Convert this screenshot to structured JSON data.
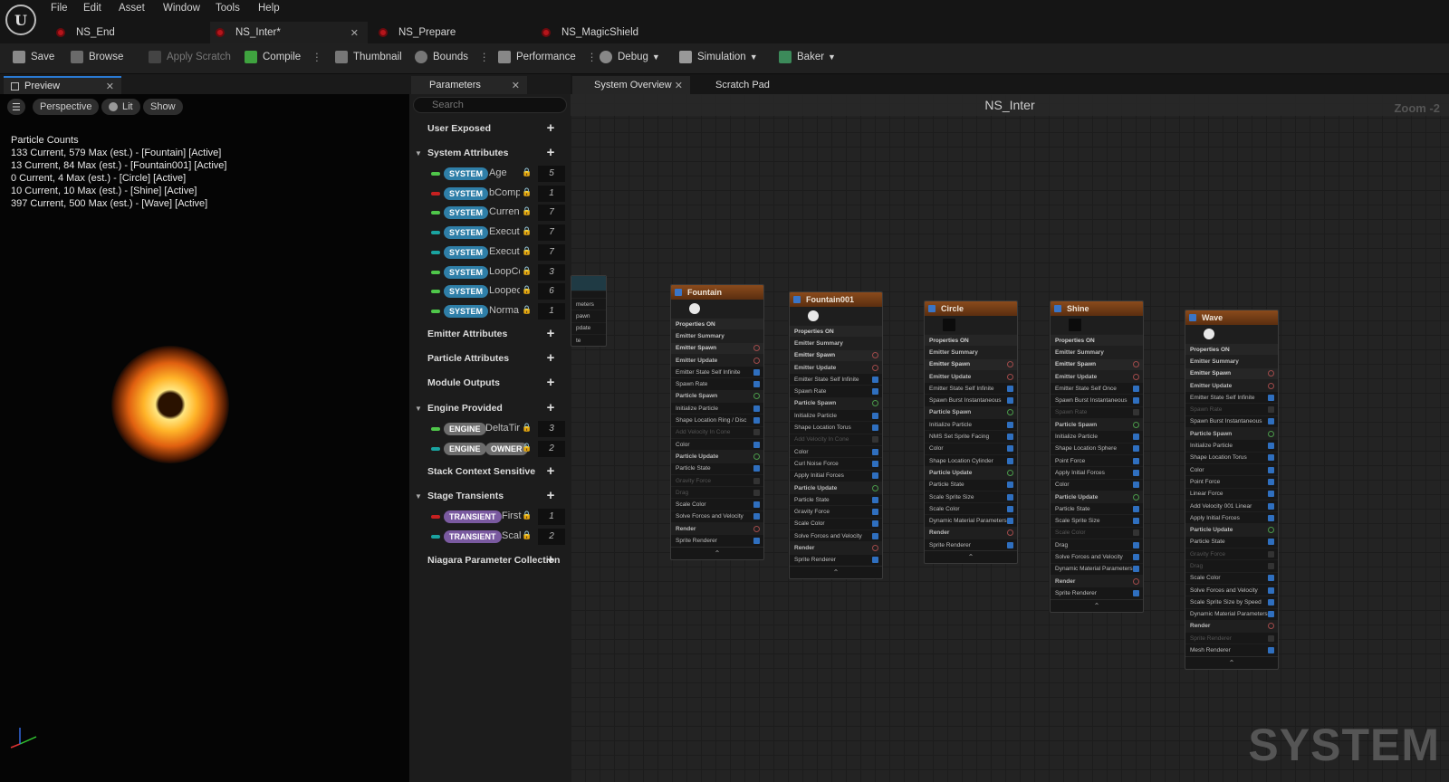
{
  "menu": {
    "items": [
      "File",
      "Edit",
      "Asset",
      "Window",
      "Tools",
      "Help"
    ]
  },
  "doc_tabs": [
    {
      "label": "NS_End"
    },
    {
      "label": "NS_Inter*"
    },
    {
      "label": "NS_Prepare"
    },
    {
      "label": "NS_MagicShield"
    }
  ],
  "toolbar": {
    "save": "Save",
    "browse": "Browse",
    "apply_scratch": "Apply Scratch",
    "compile": "Compile",
    "thumbnail": "Thumbnail",
    "bounds": "Bounds",
    "performance": "Performance",
    "debug": "Debug",
    "simulation": "Simulation",
    "baker": "Baker"
  },
  "preview": {
    "tab": "Preview",
    "perspective": "Perspective",
    "lit": "Lit",
    "show": "Show",
    "counts_title": "Particle Counts",
    "counts": [
      "133 Current, 579 Max (est.) - [Fountain] [Active]",
      "13 Current, 84 Max (est.) - [Fountain001] [Active]",
      "0 Current, 4 Max (est.) - [Circle] [Active]",
      "10 Current, 10 Max (est.) - [Shine] [Active]",
      "397 Current, 500 Max (est.) - [Wave] [Active]"
    ]
  },
  "parameters": {
    "tab": "Parameters",
    "search_placeholder": "Search",
    "categories": {
      "user_exposed": "User Exposed",
      "system_attributes": "System Attributes",
      "emitter_attributes": "Emitter Attributes",
      "particle_attributes": "Particle Attributes",
      "module_outputs": "Module Outputs",
      "engine_provided": "Engine Provided",
      "stack_context": "Stack Context Sensitive",
      "stage_transients": "Stage Transients",
      "niagara_collection": "Niagara Parameter Collection"
    },
    "system_rows": [
      {
        "tag": "SYSTEM",
        "name": "Age",
        "value": "5",
        "color": "#4fc64a"
      },
      {
        "tag": "SYSTEM",
        "name": "bComp",
        "value": "1",
        "color": "#c62020"
      },
      {
        "tag": "SYSTEM",
        "name": "Curren",
        "value": "7",
        "color": "#4fc64a"
      },
      {
        "tag": "SYSTEM",
        "name": "Execut",
        "value": "7",
        "color": "#1aa3a0"
      },
      {
        "tag": "SYSTEM",
        "name": "Execut",
        "value": "7",
        "color": "#1aa3a0"
      },
      {
        "tag": "SYSTEM",
        "name": "LoopCc",
        "value": "3",
        "color": "#4fc64a"
      },
      {
        "tag": "SYSTEM",
        "name": "Loopec",
        "value": "6",
        "color": "#4fc64a"
      },
      {
        "tag": "SYSTEM",
        "name": "Norma",
        "value": "1",
        "color": "#4fc64a"
      }
    ],
    "engine_rows": [
      {
        "tag": "ENGINE",
        "name": "DeltaTir",
        "value": "3",
        "color": "#4fc64a"
      },
      {
        "tag": "ENGINE",
        "tag2": "OWNER",
        "value": "2",
        "color": "#1aa3a0"
      }
    ],
    "transient_rows": [
      {
        "tag": "TRANSIENT",
        "name": "First",
        "value": "1",
        "color": "#c62020"
      },
      {
        "tag": "TRANSIENT",
        "name": "Scal",
        "value": "2",
        "color": "#1aa3a0"
      }
    ]
  },
  "graph": {
    "tabs": [
      "System Overview",
      "Scratch Pad"
    ],
    "title": "NS_Inter",
    "zoom": "Zoom -2",
    "watermark": "SYSTEM",
    "partial_node_rows": [
      "meters",
      "pawn",
      "pdate",
      "te"
    ]
  },
  "nodes": [
    {
      "title": "Fountain",
      "rows": [
        [
          "Properties ON",
          "sec",
          ""
        ],
        [
          "Emitter Summary",
          "grp",
          ""
        ],
        [
          "Emitter Spawn",
          "sec",
          "ro"
        ],
        [
          "Emitter Update",
          "grp",
          "ro"
        ],
        [
          "Emitter State Self Infinite",
          "",
          "ck"
        ],
        [
          "Spawn Rate",
          "",
          "ck"
        ],
        [
          "Particle Spawn",
          "grp",
          "go"
        ],
        [
          "Initialize Particle",
          "",
          "ck"
        ],
        [
          "Shape Location Ring / Disc",
          "",
          "ck"
        ],
        [
          "Add Velocity In Cone",
          "dis",
          "off"
        ],
        [
          "Color",
          "",
          "ck"
        ],
        [
          "Particle Update",
          "grp",
          "go"
        ],
        [
          "Particle State",
          "",
          "ck"
        ],
        [
          "Gravity Force",
          "dis",
          "off"
        ],
        [
          "Drag",
          "dis",
          "off"
        ],
        [
          "Scale Color",
          "",
          "ck"
        ],
        [
          "Solve Forces and Velocity",
          "",
          "ck"
        ],
        [
          "Render",
          "grp",
          "ro"
        ],
        [
          "Sprite Renderer",
          "",
          "ck"
        ]
      ]
    },
    {
      "title": "Fountain001",
      "rows": [
        [
          "Properties ON",
          "sec",
          ""
        ],
        [
          "Emitter Summary",
          "grp",
          ""
        ],
        [
          "Emitter Spawn",
          "sec",
          "ro"
        ],
        [
          "Emitter Update",
          "grp",
          "ro"
        ],
        [
          "Emitter State Self Infinite",
          "",
          "ck"
        ],
        [
          "Spawn Rate",
          "",
          "ck"
        ],
        [
          "Particle Spawn",
          "grp",
          "go"
        ],
        [
          "Initialize Particle",
          "",
          "ck"
        ],
        [
          "Shape Location Torus",
          "",
          "ck"
        ],
        [
          "Add Velocity In Cone",
          "dis",
          "off"
        ],
        [
          "Color",
          "",
          "ck"
        ],
        [
          "Curl Noise Force",
          "",
          "ck"
        ],
        [
          "Apply Initial Forces",
          "",
          "ck"
        ],
        [
          "Particle Update",
          "grp",
          "go"
        ],
        [
          "Particle State",
          "",
          "ck"
        ],
        [
          "Gravity Force",
          "",
          "ck"
        ],
        [
          "Scale Color",
          "",
          "ck"
        ],
        [
          "Solve Forces and Velocity",
          "",
          "ck"
        ],
        [
          "Render",
          "grp",
          "ro"
        ],
        [
          "Sprite Renderer",
          "",
          "ck"
        ]
      ]
    },
    {
      "title": "Circle",
      "rows": [
        [
          "Properties ON",
          "sec",
          ""
        ],
        [
          "Emitter Summary",
          "grp",
          ""
        ],
        [
          "Emitter Spawn",
          "sec",
          "ro"
        ],
        [
          "Emitter Update",
          "grp",
          "ro"
        ],
        [
          "Emitter State Self Infinite",
          "",
          "ck"
        ],
        [
          "Spawn Burst Instantaneous",
          "",
          "ck"
        ],
        [
          "Particle Spawn",
          "grp",
          "go"
        ],
        [
          "Initialize Particle",
          "",
          "ck"
        ],
        [
          "NMS Set Sprite Facing",
          "",
          "ck"
        ],
        [
          "Color",
          "",
          "ck"
        ],
        [
          "Shape Location Cylinder",
          "",
          "ck"
        ],
        [
          "Particle Update",
          "grp",
          "go"
        ],
        [
          "Particle State",
          "",
          "ck"
        ],
        [
          "Scale Sprite Size",
          "",
          "ck"
        ],
        [
          "Scale Color",
          "",
          "ck"
        ],
        [
          "Dynamic Material Parameters",
          "",
          "ck"
        ],
        [
          "Render",
          "grp",
          "ro"
        ],
        [
          "Sprite Renderer",
          "",
          "ck"
        ]
      ]
    },
    {
      "title": "Shine",
      "rows": [
        [
          "Properties ON",
          "sec",
          ""
        ],
        [
          "Emitter Summary",
          "grp",
          ""
        ],
        [
          "Emitter Spawn",
          "sec",
          "ro"
        ],
        [
          "Emitter Update",
          "grp",
          "ro"
        ],
        [
          "Emitter State Self Once",
          "",
          "ck"
        ],
        [
          "Spawn Burst Instantaneous",
          "",
          "ck"
        ],
        [
          "Spawn Rate",
          "dis",
          "off"
        ],
        [
          "Particle Spawn",
          "grp",
          "go"
        ],
        [
          "Initialize Particle",
          "",
          "ck"
        ],
        [
          "Shape Location Sphere",
          "",
          "ck"
        ],
        [
          "Point Force",
          "",
          "ck"
        ],
        [
          "Apply Initial Forces",
          "",
          "ck"
        ],
        [
          "Color",
          "",
          "ck"
        ],
        [
          "Particle Update",
          "grp",
          "go"
        ],
        [
          "Particle State",
          "",
          "ck"
        ],
        [
          "Scale Sprite Size",
          "",
          "ck"
        ],
        [
          "Scale Color",
          "dis",
          "off"
        ],
        [
          "Drag",
          "",
          "ck"
        ],
        [
          "Solve Forces and Velocity",
          "",
          "ck"
        ],
        [
          "Dynamic Material Parameters",
          "",
          "ck"
        ],
        [
          "Render",
          "grp",
          "ro"
        ],
        [
          "Sprite Renderer",
          "",
          "ck"
        ]
      ]
    },
    {
      "title": "Wave",
      "rows": [
        [
          "Properties ON",
          "sec",
          ""
        ],
        [
          "Emitter Summary",
          "grp",
          ""
        ],
        [
          "Emitter Spawn",
          "sec",
          "ro"
        ],
        [
          "Emitter Update",
          "grp",
          "ro"
        ],
        [
          "Emitter State Self Infinite",
          "",
          "ck"
        ],
        [
          "Spawn Rate",
          "dis",
          "off"
        ],
        [
          "Spawn Burst Instantaneous",
          "",
          "ck"
        ],
        [
          "Particle Spawn",
          "grp",
          "go"
        ],
        [
          "Initialize Particle",
          "",
          "ck"
        ],
        [
          "Shape Location Torus",
          "",
          "ck"
        ],
        [
          "Color",
          "",
          "ck"
        ],
        [
          "Point Force",
          "",
          "ck"
        ],
        [
          "Linear Force",
          "",
          "ck"
        ],
        [
          "Add Velocity 001 Linear",
          "",
          "ck"
        ],
        [
          "Apply Initial Forces",
          "",
          "ck"
        ],
        [
          "Particle Update",
          "grp",
          "go"
        ],
        [
          "Particle State",
          "",
          "ck"
        ],
        [
          "Gravity Force",
          "dis",
          "off"
        ],
        [
          "Drag",
          "dis",
          "off"
        ],
        [
          "Scale Color",
          "",
          "ck"
        ],
        [
          "Solve Forces and Velocity",
          "",
          "ck"
        ],
        [
          "Scale Sprite Size by Speed",
          "",
          "ck"
        ],
        [
          "Dynamic Material Parameters",
          "",
          "ck"
        ],
        [
          "Render",
          "grp",
          "ro"
        ],
        [
          "Sprite Renderer",
          "dis",
          "off"
        ],
        [
          "Mesh Renderer",
          "",
          "ck"
        ]
      ]
    }
  ]
}
